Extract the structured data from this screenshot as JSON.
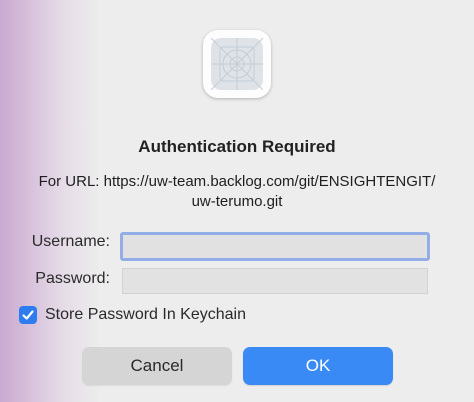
{
  "dialog": {
    "app_icon": "app-placeholder-icon",
    "title": "Authentication Required",
    "url_line_1": "For URL: https://uw-team.backlog.com/git/ENSIGHTENGIT/",
    "url_line_2": "uw-terumo.git"
  },
  "form": {
    "username_label": "Username:",
    "username_value": "",
    "password_label": "Password:",
    "password_value": "",
    "store_checked": true,
    "store_label": "Store Password In Keychain"
  },
  "buttons": {
    "cancel_label": "Cancel",
    "ok_label": "OK"
  },
  "colors": {
    "accent": "#3a8af5",
    "focus_ring": "#93aee6"
  }
}
